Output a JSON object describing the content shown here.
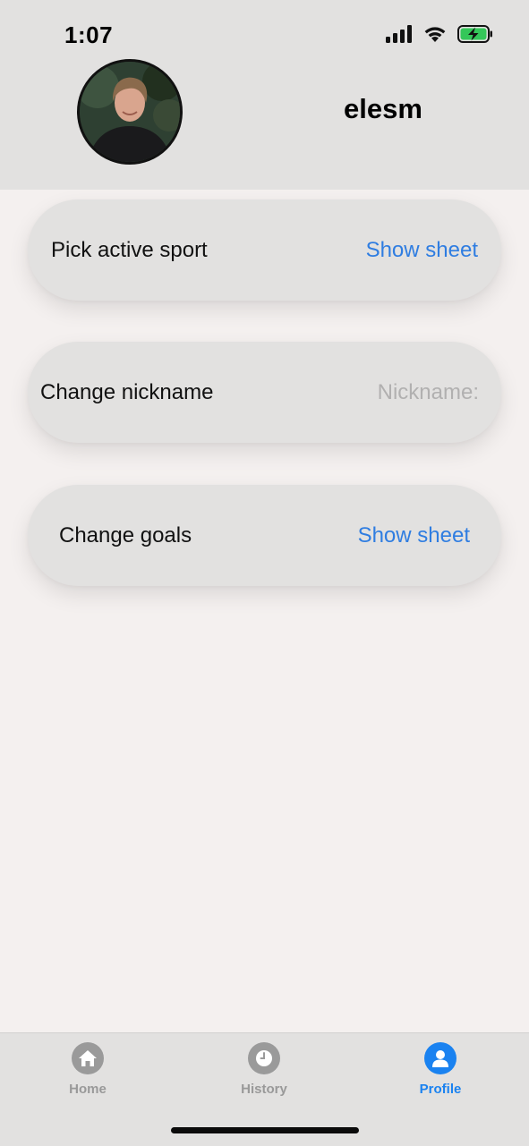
{
  "status_bar": {
    "time": "1:07",
    "icons": [
      "cellular-signal-icon",
      "wifi-icon",
      "battery-charging-icon"
    ],
    "battery_color": "#34c759"
  },
  "profile": {
    "username": "elesm",
    "avatar": "profile-photo"
  },
  "settings": {
    "sport": {
      "label": "Pick active sport",
      "action": "Show sheet"
    },
    "nickname": {
      "label": "Change nickname",
      "placeholder": "Nickname:",
      "value": ""
    },
    "goals": {
      "label": "Change goals",
      "action": "Show sheet"
    }
  },
  "tabbar": {
    "tabs": [
      {
        "label": "Home",
        "icon": "house-icon",
        "active": false
      },
      {
        "label": "History",
        "icon": "clock-icon",
        "active": false
      },
      {
        "label": "Profile",
        "icon": "person-icon",
        "active": true
      }
    ]
  },
  "colors": {
    "accent": "#1a82f0",
    "link": "#2f7de1",
    "header_background": "#e2e1e0",
    "page_background": "#f4f0ef"
  }
}
